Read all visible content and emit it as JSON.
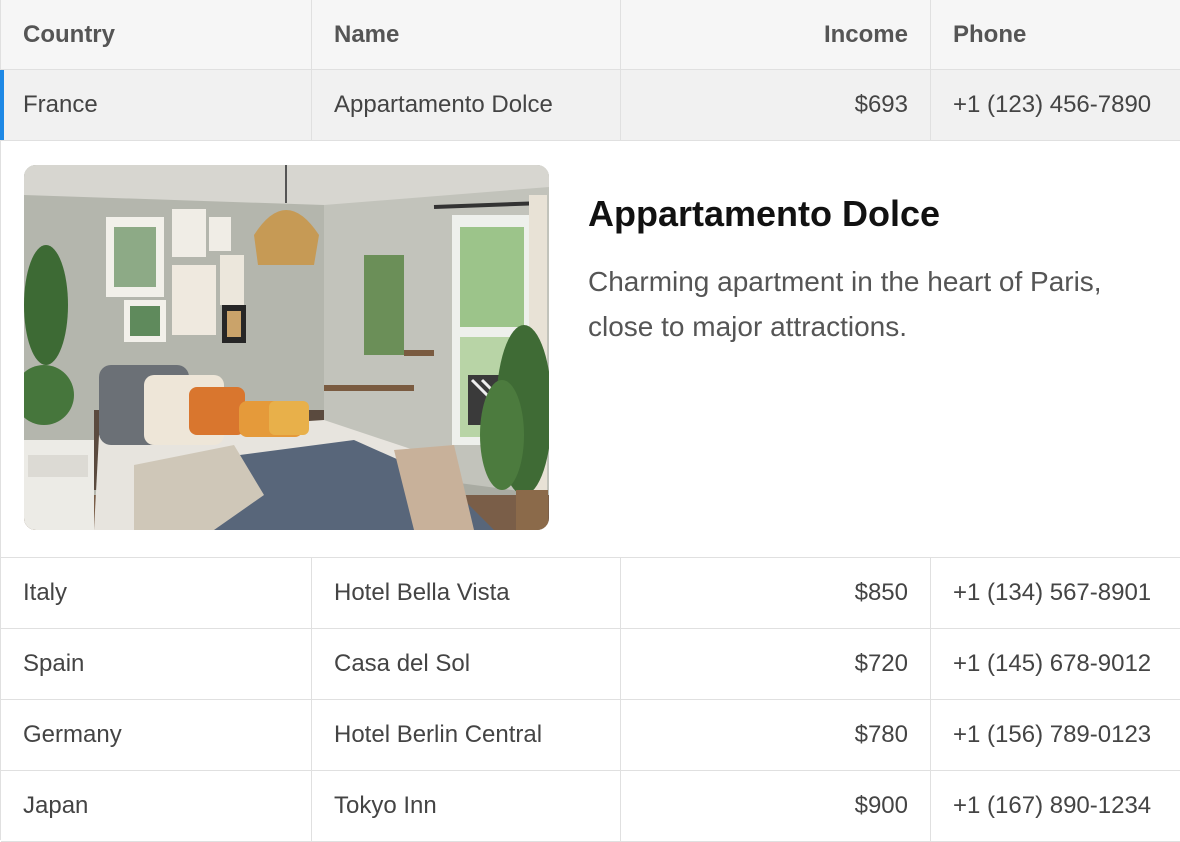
{
  "columns": {
    "country": "Country",
    "name": "Name",
    "income": "Income",
    "phone": "Phone"
  },
  "selected_row": {
    "country": "France",
    "name": "Appartamento Dolce",
    "income": "$693",
    "phone": "+1 (123) 456-7890"
  },
  "detail": {
    "title": "Appartamento Dolce",
    "description": "Charming apartment in the heart of Paris, close to major attractions."
  },
  "rows": [
    {
      "country": "Italy",
      "name": "Hotel Bella Vista",
      "income": "$850",
      "phone": "+1 (134) 567-8901"
    },
    {
      "country": "Spain",
      "name": "Casa del Sol",
      "income": "$720",
      "phone": "+1 (145) 678-9012"
    },
    {
      "country": "Germany",
      "name": "Hotel Berlin Central",
      "income": "$780",
      "phone": "+1 (156) 789-0123"
    },
    {
      "country": "Japan",
      "name": "Tokyo Inn",
      "income": "$900",
      "phone": "+1 (167) 890-1234"
    }
  ],
  "colors": {
    "selection_accent": "#1e88e5",
    "header_bg": "#f6f6f6",
    "selected_row_bg": "#f1f1f1"
  }
}
